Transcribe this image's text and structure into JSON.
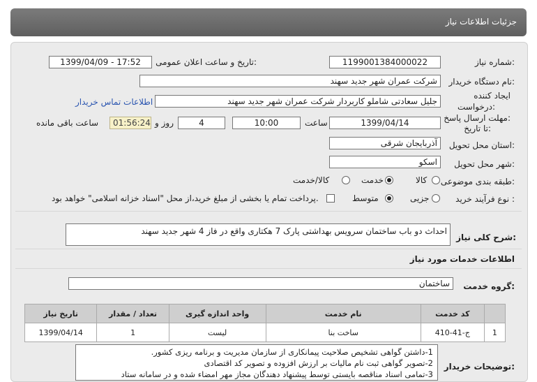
{
  "header": {
    "title": "جزئیات اطلاعات نیاز"
  },
  "fields": {
    "need_number_label": "شماره نیاز:",
    "need_number": "1199001384000022",
    "announce_label": "تاریخ و ساعت اعلان عمومی:",
    "announce_value": "1399/04/09 - 17:52",
    "buyer_label": "نام دستگاه خریدار:",
    "buyer_value": "شرکت عمران شهر جدید سهند",
    "creator_label_1": "ایجاد کننده",
    "creator_label_2": "درخواست:",
    "creator_value": "جلیل سعادتی شاملو کاربردار شرکت عمران شهر جدید سهند",
    "contact_link": "اطلاعات تماس خریدار",
    "deadline_label_1": "مهلت ارسال پاسخ:",
    "deadline_label_2": "تا تاریخ:",
    "deadline_date": "1399/04/14",
    "time_label": "ساعت",
    "deadline_time": "10:00",
    "days_value": "4",
    "days_label": "روز و",
    "remaining_time": "01:56:24",
    "remaining_label": "ساعت باقی مانده",
    "province_label": "استان محل تحویل:",
    "province_value": "آذربایجان شرقی",
    "city_label": "شهر محل تحویل:",
    "city_value": "اسکو",
    "category_label": "طبقه بندی موضوعی:",
    "category_options": [
      "کالا",
      "خدمت",
      "کالا/خدمت"
    ],
    "purchase_label": "نوع فرآیند خرید :",
    "purchase_options": [
      "جزیی",
      "متوسط"
    ],
    "payment_note": "پرداخت تمام یا بخشی از مبلغ خرید،از محل \"اسناد خزانه اسلامی\" خواهد بود.",
    "summary_label": "شرح کلی نیاز:",
    "summary_value": "احداث دو باب ساختمان سرویس بهداشتی پارک 7 هکتاری واقع در فاز 4 شهر جدید سهند",
    "services_title": "اطلاعات خدمات مورد نیاز",
    "service_group_label": "گروه خدمت:",
    "service_group_value": "ساختمان",
    "desc_label": "توضیحات خریدار:"
  },
  "table": {
    "headers": [
      "",
      "کد خدمت",
      "نام خدمت",
      "واحد اندازه گیری",
      "تعداد / مقدار",
      "تاریخ نیاز"
    ],
    "rows": [
      [
        "1",
        "ج-41-410",
        "ساخت بنا",
        "لیست",
        "1",
        "1399/04/14"
      ]
    ]
  },
  "description_lines": [
    "1-داشتن گواهی تشخیص صلاحیت پیمانکاری از سازمان مدیریت و برنامه ریزی کشور.",
    "2-تصویر گواهی ثبت نام مالیات بر ارزش افزوده و تصویر کد اقتصادی",
    "3-تمامی اسناد مناقصه بایستی توسط پیشنهاد دهندگان مجاز مهر امضاء شده و در سامانه ستاد"
  ]
}
